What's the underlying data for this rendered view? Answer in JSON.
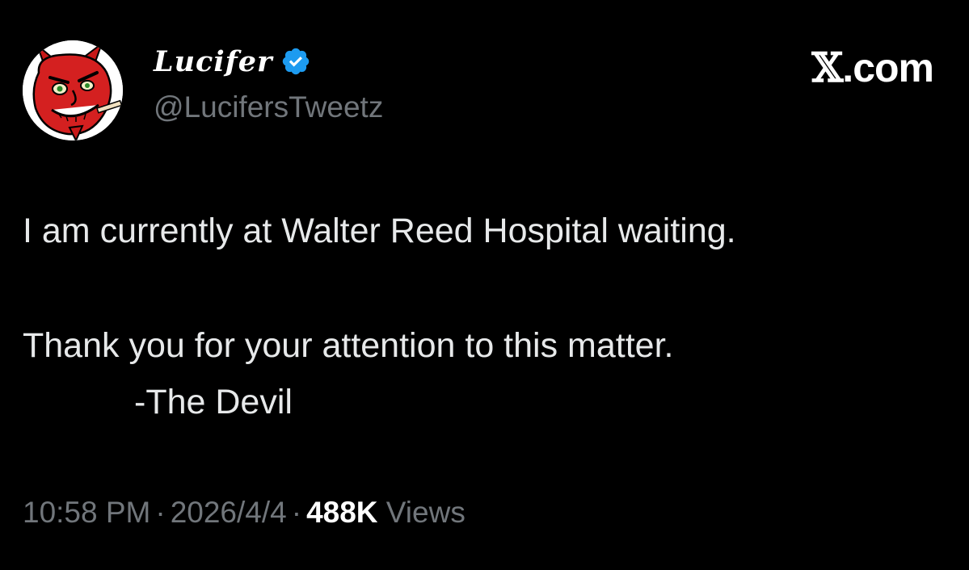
{
  "author": {
    "display_name": "Lucifer",
    "handle": "@LucifersTweetz",
    "verified_icon": "verified-badge-icon",
    "avatar_icon": "red-devil-cartoon-avatar"
  },
  "watermark": {
    "x_glyph": "𝕏",
    "domain": ".com"
  },
  "tweet": {
    "line1": "I am currently at Walter Reed Hospital waiting.",
    "line2": "Thank you for your attention to this matter.",
    "line3": "-The Devil"
  },
  "meta": {
    "time": "10:58 PM",
    "separator": "·",
    "date": "2026/4/4",
    "views_count": "488K",
    "views_label": "Views"
  },
  "colors": {
    "background": "#000000",
    "text_primary": "#e7e9ea",
    "text_secondary": "#71767b",
    "verified_blue": "#1d9bf0",
    "devil_red": "#d42020"
  }
}
